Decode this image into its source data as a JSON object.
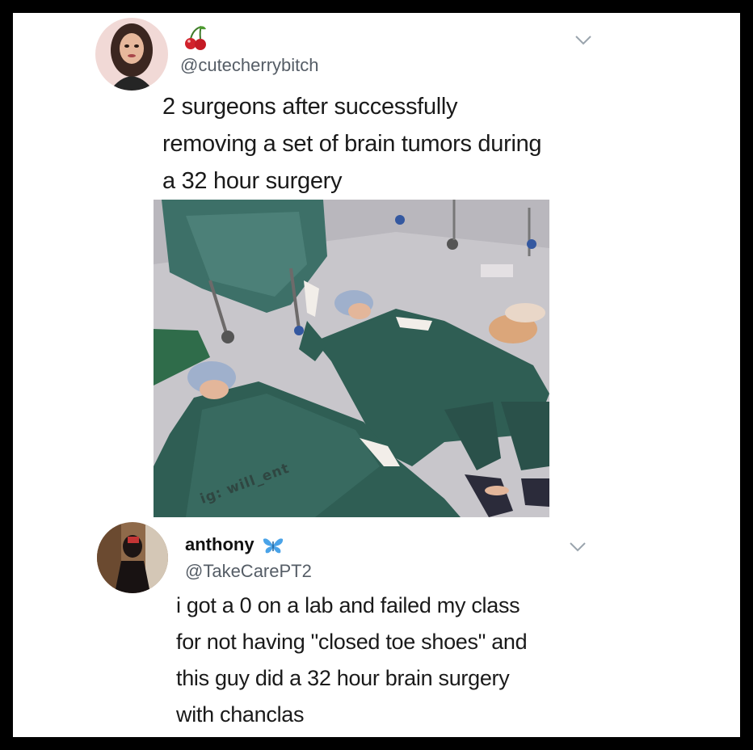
{
  "tweet1": {
    "handle": "@cutecherrybitch",
    "text_lines": [
      "2 surgeons after successfully",
      "removing a set of brain tumors during",
      "a 32 hour surgery"
    ],
    "avatar_icon": "bratz-doll-avatar",
    "badge_icon": "cherry-emoji-icon",
    "menu_icon": "chevron-down-icon",
    "image_watermark": "ig: will_ent"
  },
  "tweet2": {
    "name": "anthony",
    "handle": "@TakeCarePT2",
    "text_lines": [
      "i got a 0 on a lab and failed my class",
      "for not having \"closed toe shoes\" and",
      "this guy did a 32 hour brain surgery",
      "with chanclas"
    ],
    "avatar_icon": "profile-photo-avatar",
    "badge_icon": "butterfly-emoji-icon",
    "menu_icon": "chevron-down-icon"
  },
  "colors": {
    "frame_border": "#000000",
    "background": "#ffffff",
    "text": "#1a1a1a",
    "handle": "#555d66",
    "scrubs": "#2f5e54"
  }
}
